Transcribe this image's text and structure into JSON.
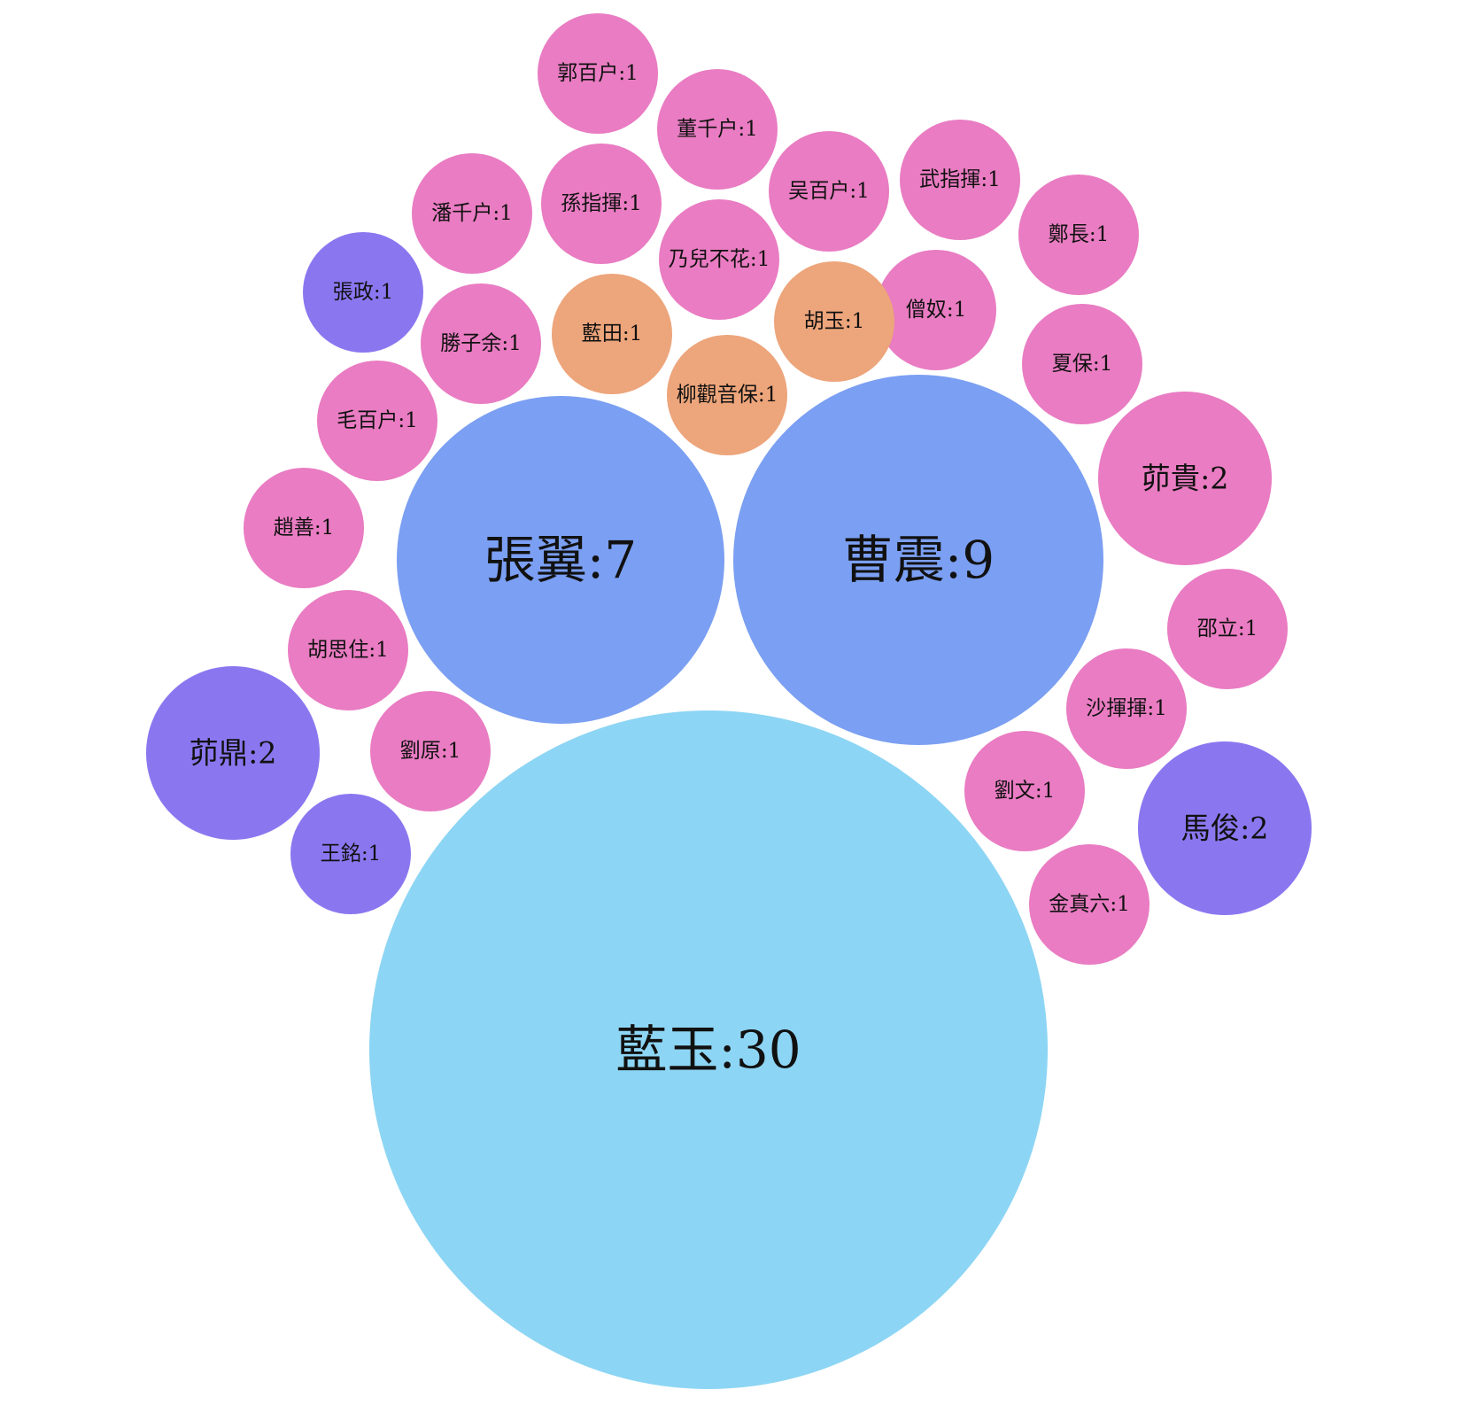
{
  "chart_data": {
    "type": "bubble",
    "title": "",
    "colors": {
      "light-blue": "#8dd5f4",
      "blue": "#7b9ff2",
      "purple": "#8a77f0",
      "pink": "#e97cc2",
      "orange": "#eda57b"
    },
    "nodes": [
      {
        "name": "藍玉",
        "value": 30,
        "label": "藍玉:30",
        "color": "light-blue"
      },
      {
        "name": "曹震",
        "value": 9,
        "label": "曹震:9",
        "color": "blue"
      },
      {
        "name": "張翼",
        "value": 7,
        "label": "張翼:7",
        "color": "blue"
      },
      {
        "name": "茆貴",
        "value": 2,
        "label": "茆貴:2",
        "color": "pink"
      },
      {
        "name": "茆鼎",
        "value": 2,
        "label": "茆鼎:2",
        "color": "purple"
      },
      {
        "name": "馬俊",
        "value": 2,
        "label": "馬俊:2",
        "color": "purple"
      },
      {
        "name": "郭百户",
        "value": 1,
        "label": "郭百户:1",
        "color": "pink"
      },
      {
        "name": "董千户",
        "value": 1,
        "label": "董千户:1",
        "color": "pink"
      },
      {
        "name": "孫指揮",
        "value": 1,
        "label": "孫指揮:1",
        "color": "pink"
      },
      {
        "name": "吴百户",
        "value": 1,
        "label": "吴百户:1",
        "color": "pink"
      },
      {
        "name": "武指揮",
        "value": 1,
        "label": "武指揮:1",
        "color": "pink"
      },
      {
        "name": "潘千户",
        "value": 1,
        "label": "潘千户:1",
        "color": "pink"
      },
      {
        "name": "鄭長",
        "value": 1,
        "label": "鄭長:1",
        "color": "pink"
      },
      {
        "name": "乃兒不花",
        "value": 1,
        "label": "乃兒不花:1",
        "color": "pink"
      },
      {
        "name": "張政",
        "value": 1,
        "label": "張政:1",
        "color": "purple"
      },
      {
        "name": "僧奴",
        "value": 1,
        "label": "僧奴:1",
        "color": "pink"
      },
      {
        "name": "胡玉",
        "value": 1,
        "label": "胡玉:1",
        "color": "orange"
      },
      {
        "name": "藍田",
        "value": 1,
        "label": "藍田:1",
        "color": "orange"
      },
      {
        "name": "勝子余",
        "value": 1,
        "label": "勝子余:1",
        "color": "pink"
      },
      {
        "name": "夏保",
        "value": 1,
        "label": "夏保:1",
        "color": "pink"
      },
      {
        "name": "柳觀音保",
        "value": 1,
        "label": "柳觀音保:1",
        "color": "orange"
      },
      {
        "name": "毛百户",
        "value": 1,
        "label": "毛百户:1",
        "color": "pink"
      },
      {
        "name": "趙善",
        "value": 1,
        "label": "趙善:1",
        "color": "pink"
      },
      {
        "name": "邵立",
        "value": 1,
        "label": "邵立:1",
        "color": "pink"
      },
      {
        "name": "胡思住",
        "value": 1,
        "label": "胡思住:1",
        "color": "pink"
      },
      {
        "name": "沙揮揮",
        "value": 1,
        "label": "沙揮揮:1",
        "color": "pink"
      },
      {
        "name": "劉原",
        "value": 1,
        "label": "劉原:1",
        "color": "pink"
      },
      {
        "name": "劉文",
        "value": 1,
        "label": "劉文:1",
        "color": "pink"
      },
      {
        "name": "王銘",
        "value": 1,
        "label": "王銘:1",
        "color": "purple"
      },
      {
        "name": "金真六",
        "value": 1,
        "label": "金真六:1",
        "color": "pink"
      }
    ]
  }
}
